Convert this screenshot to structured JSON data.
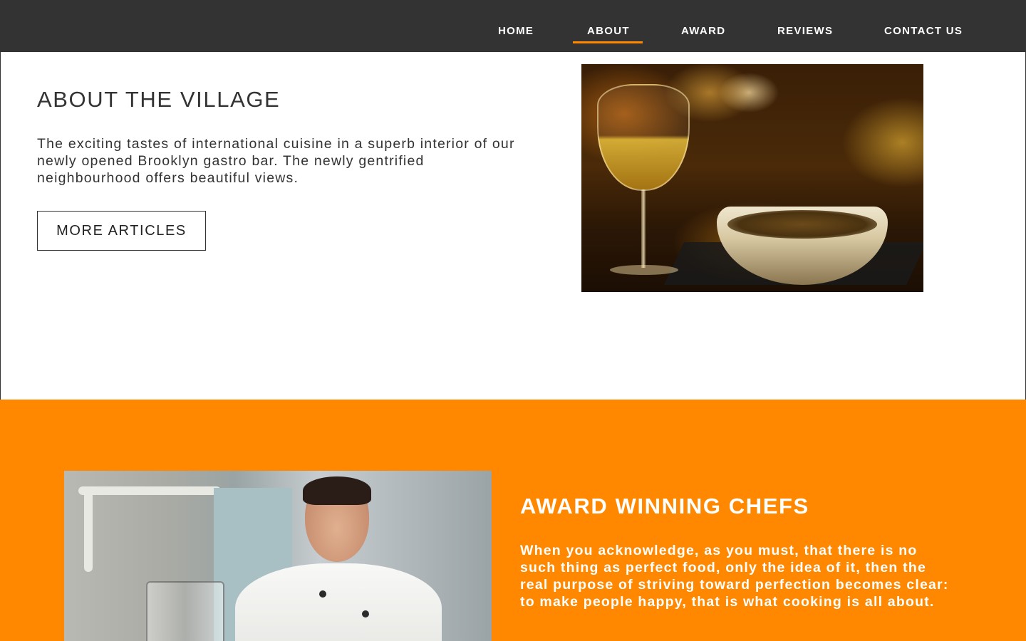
{
  "nav": {
    "items": [
      {
        "label": "HOME"
      },
      {
        "label": "ABOUT"
      },
      {
        "label": "AWARD"
      },
      {
        "label": "REVIEWS"
      },
      {
        "label": "CONTACT US"
      }
    ],
    "active": "ABOUT"
  },
  "about": {
    "title": "ABOUT THE VILLAGE",
    "text": "The exciting tastes of international cuisine in a superb interior of our newly opened Brooklyn gastro bar. The newly gentrified neighbourhood offers beautiful views.",
    "button_label": "MORE ARTICLES"
  },
  "award": {
    "title": "AWARD WINNING CHEFS",
    "text": "When you acknowledge, as you must, that there is no such thing as perfect food, only the idea of it, then the real purpose of striving toward perfection becomes clear: to make people happy, that is what cooking is all about."
  },
  "colors": {
    "navbar_bg": "#333333",
    "accent": "#ff8800",
    "text_dark": "#333333",
    "text_light": "#ffffff"
  }
}
